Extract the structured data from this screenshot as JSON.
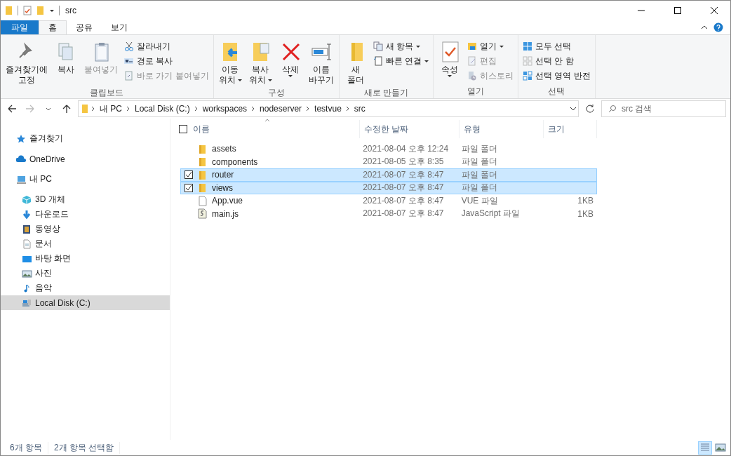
{
  "window": {
    "title": "src"
  },
  "ribbon_tabs": [
    {
      "label": "파일",
      "kind": "file",
      "selected": false
    },
    {
      "label": "홈",
      "kind": "tab",
      "selected": true
    },
    {
      "label": "공유",
      "kind": "tab",
      "selected": false
    },
    {
      "label": "보기",
      "kind": "tab",
      "selected": false
    }
  ],
  "ribbon_groups": [
    {
      "title": "클립보드",
      "large": [
        {
          "lines": [
            "즐겨찾기에",
            "고정"
          ],
          "disabled": false,
          "dropdown": false
        },
        {
          "lines": [
            "복사"
          ],
          "disabled": false,
          "dropdown": false
        },
        {
          "lines": [
            "붙여넣기"
          ],
          "disabled": true,
          "dropdown": false
        }
      ],
      "small": [
        {
          "label": "잘라내기",
          "disabled": false,
          "dropdown": false
        },
        {
          "label": "경로 복사",
          "disabled": false,
          "dropdown": false
        },
        {
          "label": "바로 가기 붙여넣기",
          "disabled": true,
          "dropdown": false
        }
      ]
    },
    {
      "title": "구성",
      "large": [
        {
          "lines": [
            "이동",
            "위치"
          ],
          "disabled": false,
          "dropdown": true
        },
        {
          "lines": [
            "복사",
            "위치"
          ],
          "disabled": false,
          "dropdown": true
        },
        {
          "lines": [
            "삭제"
          ],
          "disabled": false,
          "dropdown": true
        },
        {
          "lines": [
            "이름",
            "바꾸기"
          ],
          "disabled": false,
          "dropdown": false
        }
      ]
    },
    {
      "title": "새로 만들기",
      "large": [
        {
          "lines": [
            "새",
            "폴더"
          ],
          "disabled": false,
          "dropdown": false
        }
      ],
      "small": [
        {
          "label": "새 항목",
          "disabled": false,
          "dropdown": true
        },
        {
          "label": "빠른 연결",
          "disabled": false,
          "dropdown": true
        }
      ]
    },
    {
      "title": "열기",
      "large": [
        {
          "lines": [
            "속성"
          ],
          "disabled": false,
          "dropdown": true
        }
      ],
      "small": [
        {
          "label": "열기",
          "disabled": false,
          "dropdown": true
        },
        {
          "label": "편집",
          "disabled": true,
          "dropdown": false
        },
        {
          "label": "히스토리",
          "disabled": true,
          "dropdown": false
        }
      ]
    },
    {
      "title": "선택",
      "small": [
        {
          "label": "모두 선택",
          "disabled": false,
          "dropdown": false
        },
        {
          "label": "선택 안 함",
          "disabled": false,
          "dropdown": false
        },
        {
          "label": "선택 영역 반전",
          "disabled": false,
          "dropdown": false
        }
      ]
    }
  ],
  "address": {
    "path": [
      "내 PC",
      "Local Disk (C:)",
      "workspaces",
      "nodeserver",
      "testvue",
      "src"
    ],
    "search_placeholder": "src 검색"
  },
  "sidebar": {
    "items": [
      {
        "label": "즐겨찾기",
        "selected": false
      },
      {
        "label": "OneDrive",
        "selected": false
      },
      {
        "label": "내 PC",
        "selected": false,
        "children": [
          {
            "label": "3D 개체",
            "selected": false
          },
          {
            "label": "다운로드",
            "selected": false
          },
          {
            "label": "동영상",
            "selected": false
          },
          {
            "label": "문서",
            "selected": false
          },
          {
            "label": "바탕 화면",
            "selected": false
          },
          {
            "label": "사진",
            "selected": false
          },
          {
            "label": "음악",
            "selected": false
          },
          {
            "label": "Local Disk (C:)",
            "selected": true
          }
        ]
      }
    ]
  },
  "file_list": {
    "columns": [
      "이름",
      "수정한 날짜",
      "유형",
      "크기"
    ],
    "all_checked": false,
    "rows": [
      {
        "name": "assets",
        "modified": "2021-08-04 오후 12:24",
        "type": "파일 폴더",
        "kind": "folder",
        "selected": false
      },
      {
        "name": "components",
        "modified": "2021-08-05 오후 8:35",
        "type": "파일 폴더",
        "kind": "folder",
        "selected": false
      },
      {
        "name": "router",
        "modified": "2021-08-07 오후 8:47",
        "type": "파일 폴더",
        "kind": "folder",
        "selected": true
      },
      {
        "name": "views",
        "modified": "2021-08-07 오후 8:47",
        "type": "파일 폴더",
        "kind": "folder",
        "selected": true
      },
      {
        "name": "App.vue",
        "modified": "2021-08-07 오후 8:47",
        "type": "VUE 파일",
        "size": "1KB",
        "kind": "file",
        "selected": false
      },
      {
        "name": "main.js",
        "modified": "2021-08-07 오후 8:47",
        "type": "JavaScript 파일",
        "size": "1KB",
        "kind": "script",
        "selected": false
      }
    ]
  },
  "status_bar": {
    "item_count": "6개 항목",
    "selection": "2개 항목 선택함",
    "views": [
      {
        "kind": "details",
        "selected": true
      },
      {
        "kind": "large",
        "selected": false
      }
    ]
  }
}
